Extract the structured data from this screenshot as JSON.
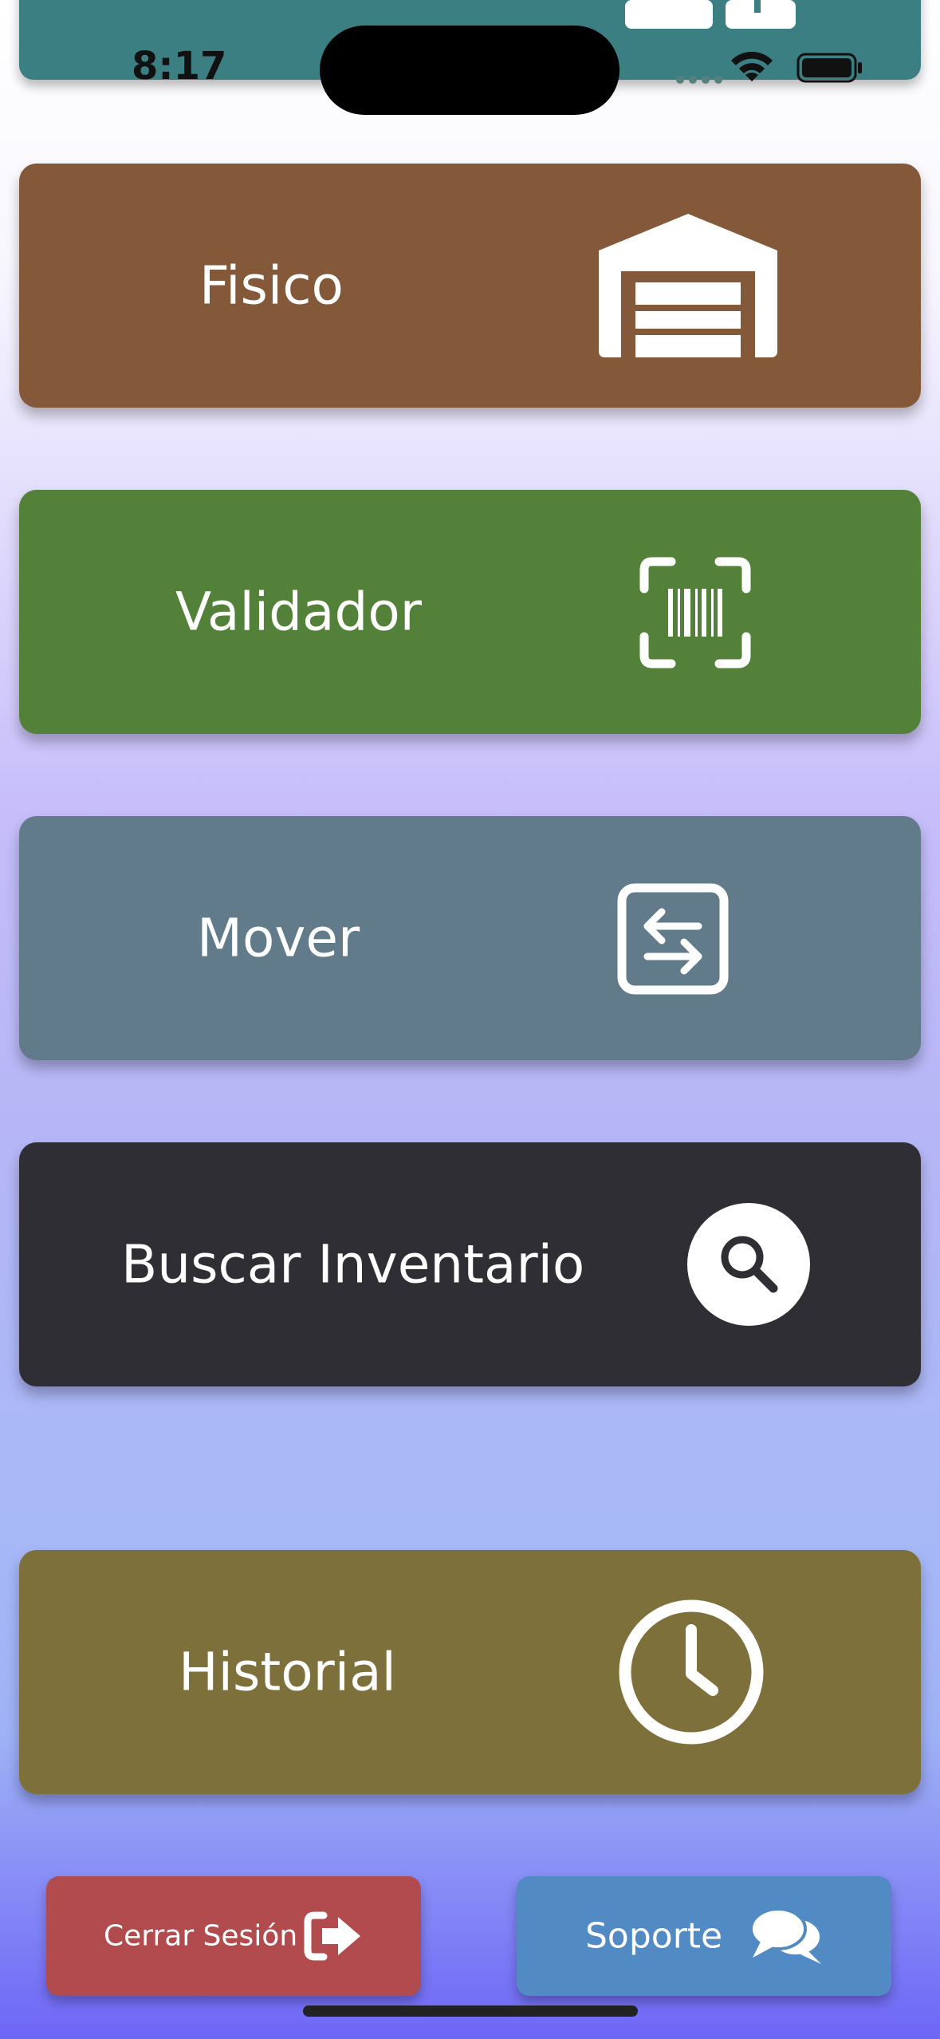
{
  "status_bar": {
    "time": "8:17"
  },
  "colors": {
    "topbar": "#3c7f82",
    "fisico": "#83593a",
    "validador": "#54813a",
    "mover": "#617b8a",
    "buscar": "#2e2e34",
    "historial": "#7e703a",
    "logout": "#b24b4d",
    "support": "#528ac3"
  },
  "menu": [
    {
      "label": "Fisico",
      "icon": "warehouse-icon"
    },
    {
      "label": "Validador",
      "icon": "barcode-scan-icon"
    },
    {
      "label": "Mover",
      "icon": "transfer-arrows-icon"
    },
    {
      "label": "Buscar Inventario",
      "icon": "search-icon"
    },
    {
      "label": "Historial",
      "icon": "clock-icon"
    }
  ],
  "footer": {
    "logout_label": "Cerrar Sesión",
    "logout_icon": "sign-out-icon",
    "support_label": "Soporte",
    "support_icon": "chat-bubbles-icon"
  }
}
